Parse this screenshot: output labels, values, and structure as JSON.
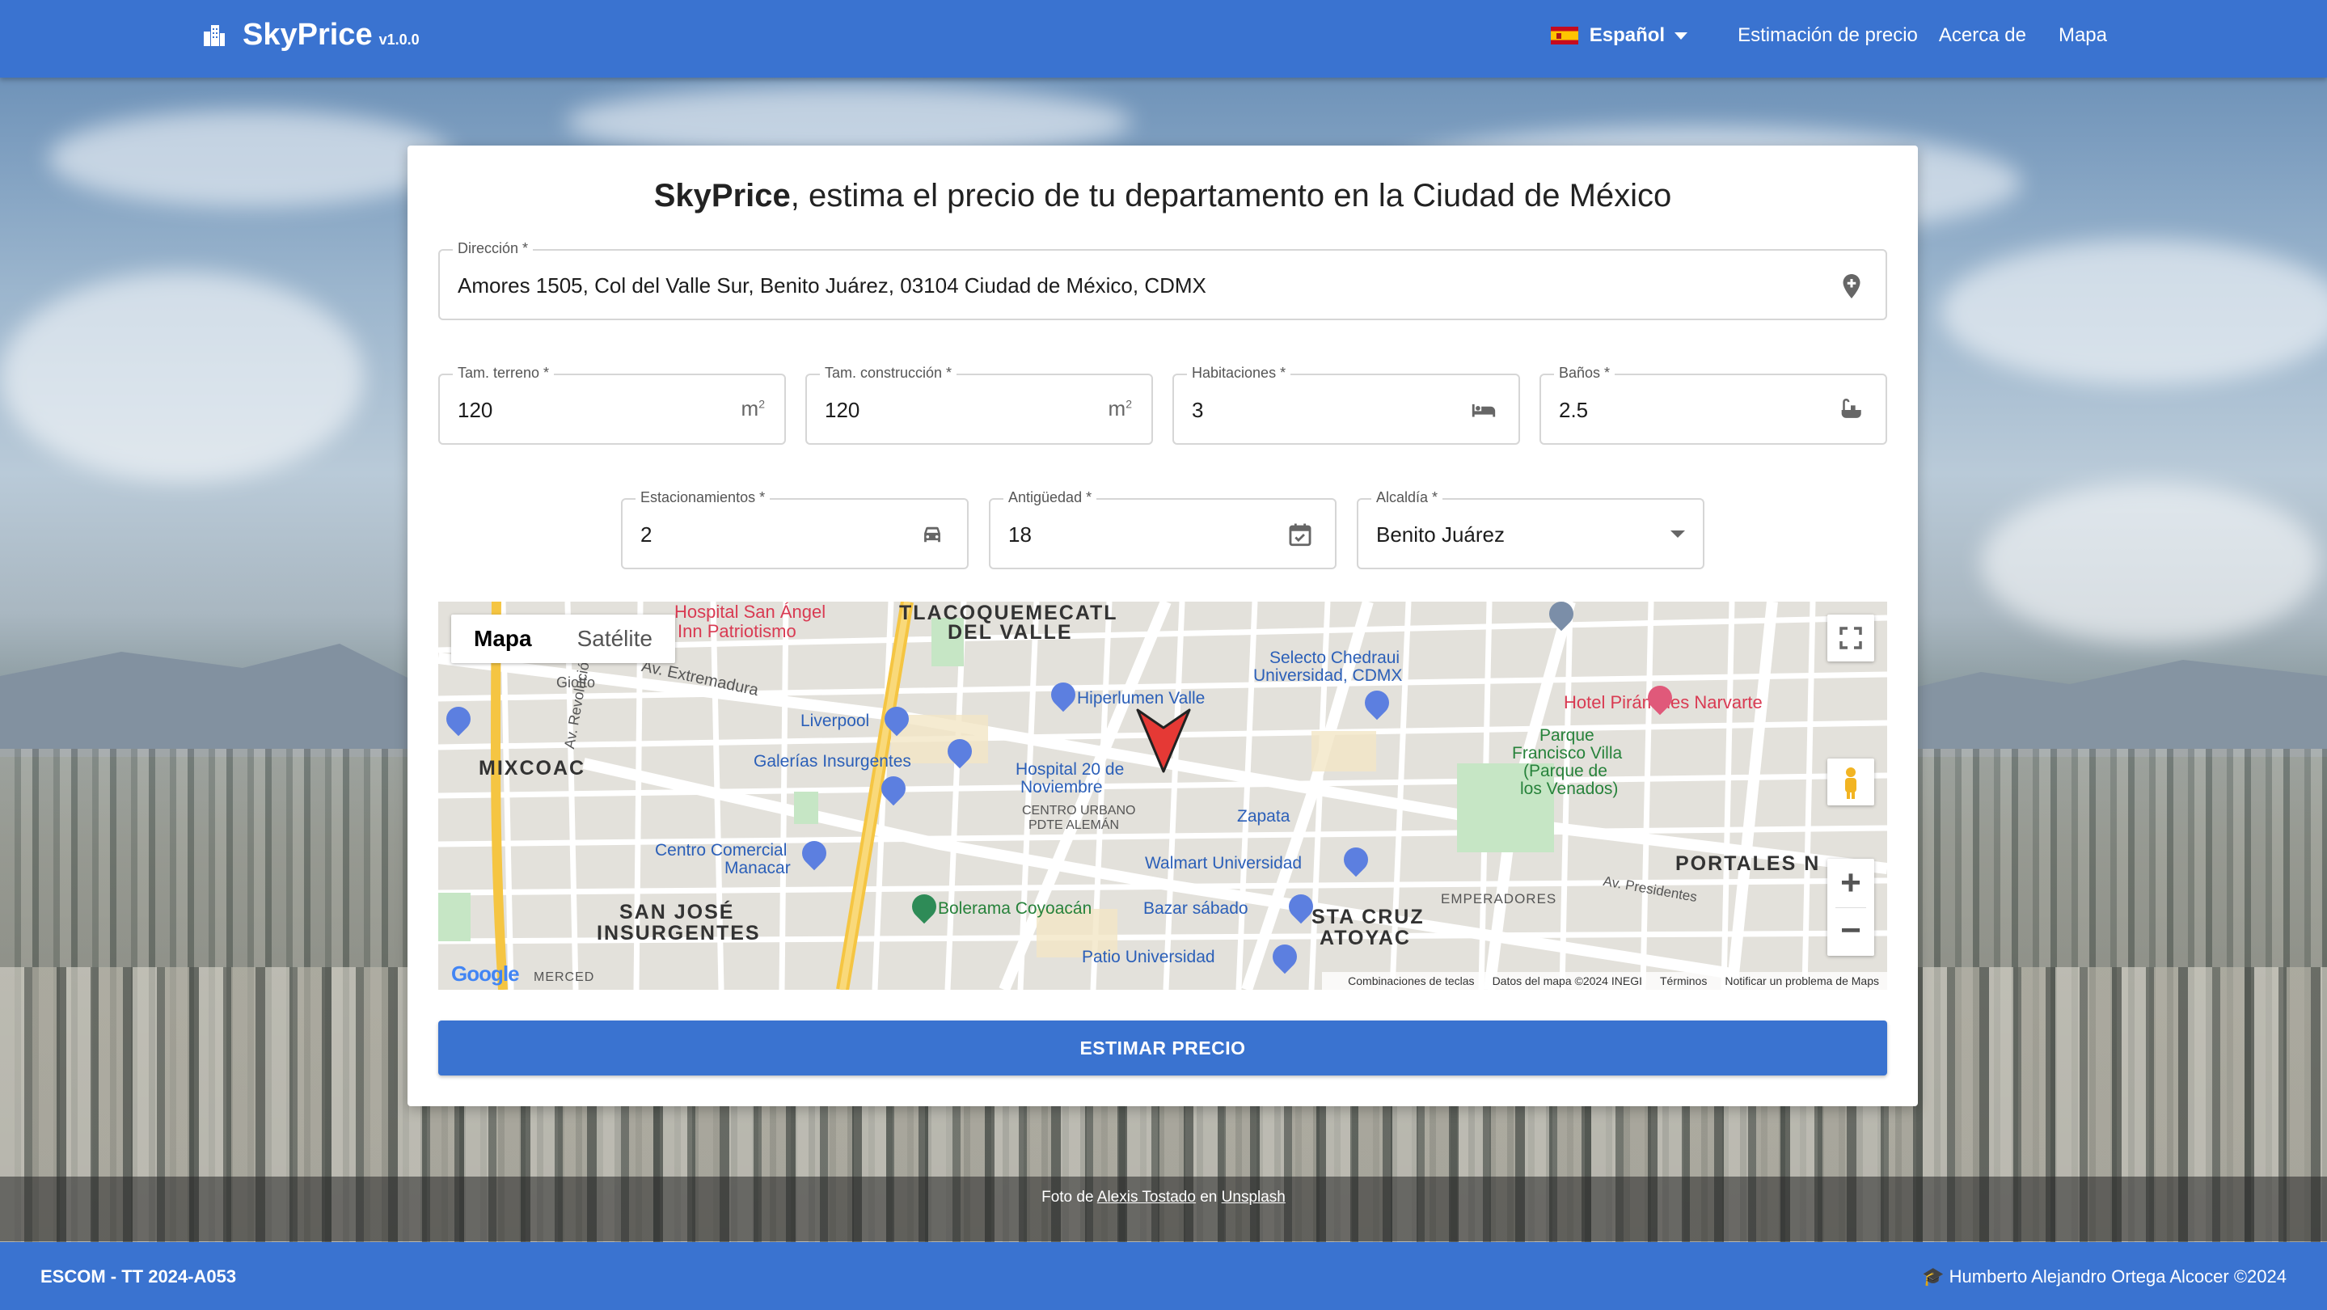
{
  "header": {
    "brand_name": "SkyPrice",
    "brand_version": "v1.0.0",
    "language": "Español",
    "nav": [
      "Estimación de precio",
      "Acerca de",
      "Mapa"
    ]
  },
  "form": {
    "title_brand": "SkyPrice",
    "title_rest": ", estima el precio de tu departamento en la Ciudad de México",
    "direccion": {
      "label": "Dirección *",
      "value": "Amores 1505, Col del Valle Sur, Benito Juárez, 03104 Ciudad de México, CDMX"
    },
    "terreno": {
      "label": "Tam. terreno *",
      "value": "120",
      "unit": "m",
      "unit_sup": "2"
    },
    "construccion": {
      "label": "Tam. construcción *",
      "value": "120",
      "unit": "m",
      "unit_sup": "2"
    },
    "habitaciones": {
      "label": "Habitaciones *",
      "value": "3"
    },
    "banos": {
      "label": "Baños *",
      "value": "2.5"
    },
    "estacionamientos": {
      "label": "Estacionamientos *",
      "value": "2"
    },
    "antiguedad": {
      "label": "Antigüedad *",
      "value": "18"
    },
    "alcaldia": {
      "label": "Alcaldía *",
      "value": "Benito Juárez"
    },
    "submit": "ESTIMAR PRECIO"
  },
  "map": {
    "tab_map": "Mapa",
    "tab_satellite": "Satélite",
    "google": "Google",
    "footer": [
      "Combinaciones de teclas",
      "Datos del mapa ©2024 INEGI",
      "Términos",
      "Notificar un problema de Maps"
    ],
    "labels": {
      "tlacoquemecatl": "TLACOQUEMECATL",
      "del_valle": "DEL VALLE",
      "mixcoac": "MIXCOAC",
      "san_jose": "SAN JOSÉ",
      "insurgentes": "INSURGENTES",
      "sta_cruz": "STA CRUZ",
      "atoyac": "ATOYAC",
      "portales": "PORTALES N",
      "hospital_san_angel": "Hospital San Ángel",
      "inn_patriotismo": "Inn Patriotismo",
      "hiperlumen": "Hiperlumen Valle",
      "liverpool": "Liverpool",
      "galerias": "Galerías Insurgentes",
      "hospital_20_a": "Hospital 20 de",
      "hospital_20_b": "Noviembre",
      "centro_urbano_a": "CENTRO URBANO",
      "centro_urbano_b": "PDTE ALEMÁN",
      "selecto_a": "Selecto Chedraui",
      "selecto_b": "Universidad, CDMX",
      "hotel": "Hotel Pirámides Narvarte",
      "parque_a": "Parque",
      "parque_b": "Francisco Villa",
      "parque_c": "(Parque de",
      "parque_d": "los Venados)",
      "zapata": "Zapata",
      "walmart": "Walmart Universidad",
      "centro_comercial_a": "Centro Comercial",
      "centro_comercial_b": "Manacar",
      "bolerama": "Bolerama Coyoacán",
      "bazar": "Bazar sábado",
      "patio": "Patio Universidad",
      "extremadura": "Av. Extremadura",
      "revolucion": "Av. Revolución",
      "emperadores": "EMPERADORES",
      "presidentes": "Av. Presidentes",
      "giotto": "Giotto",
      "merced": "MERCED"
    }
  },
  "photo_credit": {
    "prefix": "Foto de ",
    "author": "Alexis Tostado",
    "mid": " en ",
    "site": "Unsplash"
  },
  "footer": {
    "left": "ESCOM - TT 2024-A053",
    "right": "🎓 Humberto Alejandro Ortega Alcocer ©2024"
  },
  "colors": {
    "primary": "#3a73d0",
    "pin": "#e53935"
  }
}
